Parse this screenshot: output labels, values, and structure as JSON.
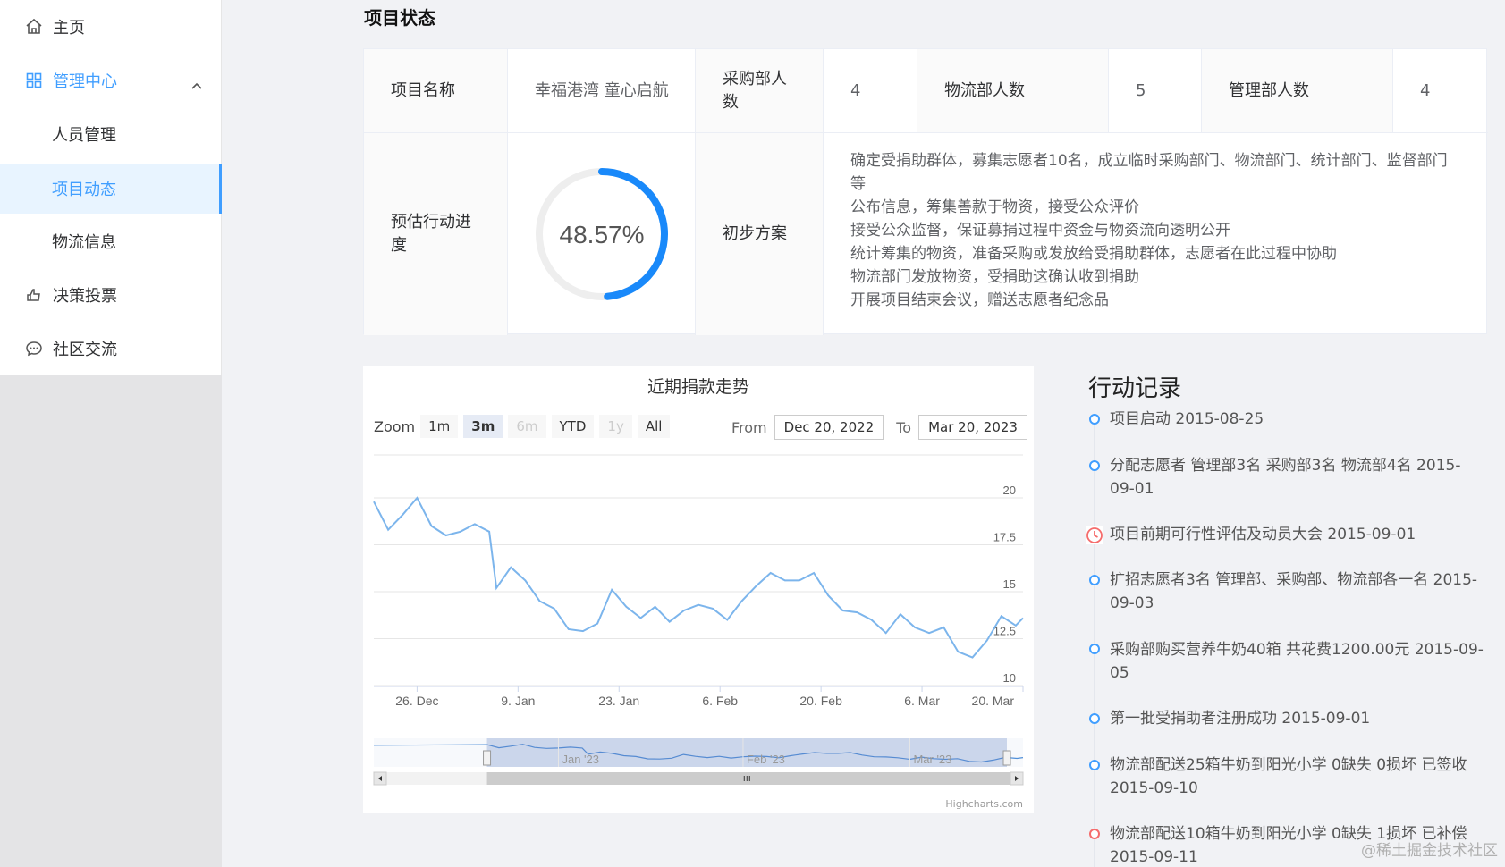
{
  "sidebar": {
    "items": [
      {
        "label": "主页",
        "icon": "home-icon"
      },
      {
        "label": "管理中心",
        "icon": "grid-icon"
      },
      {
        "label": "人员管理"
      },
      {
        "label": "项目动态"
      },
      {
        "label": "物流信息"
      },
      {
        "label": "决策投票",
        "icon": "vote-icon"
      },
      {
        "label": "社区交流",
        "icon": "chat-icon"
      }
    ],
    "accent": "#409eff"
  },
  "status": {
    "title": "项目状态",
    "project_name_label": "项目名称",
    "project_name": "幸福港湾 童心启航",
    "purchase_label": "采购部人数",
    "purchase_count": "4",
    "logistics_label": "物流部人数",
    "logistics_count": "5",
    "management_label": "管理部人数",
    "management_count": "4",
    "progress_label": "预估行动进度",
    "progress_text": "48.57%",
    "progress_value": 48.57,
    "plan_label": "初步方案",
    "plan_lines": [
      "确定受捐助群体，募集志愿者10名，成立临时采购部门、物流部门、统计部门、监督部门等",
      "公布信息，筹集善款于物资，接受公众评价",
      "接受公众监督，保证募捐过程中资金与物资流向透明公开",
      "统计筹集的物资，准备采购或发放给受捐助群体，志愿者在此过程中协助",
      "物流部门发放物资，受捐助这确认收到捐助",
      "开展项目结束会议，赠送志愿者纪念品"
    ]
  },
  "chart": {
    "zoom_label": "Zoom",
    "zoom_buttons": [
      "1m",
      "3m",
      "6m",
      "YTD",
      "1y",
      "All"
    ],
    "from_label": "From",
    "from_value": "Dec 20, 2022",
    "to_label": "To",
    "to_value": "Mar 20, 2023",
    "navigator_labels": [
      "Jan '23",
      "Feb '23",
      "Mar '23"
    ],
    "credits": "Highcharts.com",
    "line_color": "#7cb5ec"
  },
  "chart_data": {
    "type": "line",
    "title": "近期捐款走势",
    "x_tick_labels": [
      "26. Dec",
      "9. Jan",
      "23. Jan",
      "6. Feb",
      "20. Feb",
      "6. Mar",
      "20. Mar"
    ],
    "y_tick_labels": [
      "10",
      "12.5",
      "15",
      "17.5",
      "20"
    ],
    "ylim": [
      10,
      20
    ],
    "xlim": [
      "2022-12-20",
      "2023-03-20"
    ],
    "grid": true,
    "series": [
      {
        "x": [
          "2022-12-20",
          "2022-12-22",
          "2022-12-24",
          "2022-12-26",
          "2022-12-28",
          "2022-12-30",
          "2023-01-01",
          "2023-01-03",
          "2023-01-05",
          "2023-01-06",
          "2023-01-08",
          "2023-01-10",
          "2023-01-12",
          "2023-01-14",
          "2023-01-16",
          "2023-01-18",
          "2023-01-20",
          "2023-01-22",
          "2023-01-24",
          "2023-01-26",
          "2023-01-28",
          "2023-01-30",
          "2023-02-01",
          "2023-02-03",
          "2023-02-05",
          "2023-02-07",
          "2023-02-09",
          "2023-02-11",
          "2023-02-13",
          "2023-02-15",
          "2023-02-17",
          "2023-02-19",
          "2023-02-21",
          "2023-02-23",
          "2023-02-25",
          "2023-02-27",
          "2023-03-01",
          "2023-03-03",
          "2023-03-05",
          "2023-03-07",
          "2023-03-09",
          "2023-03-11",
          "2023-03-13",
          "2023-03-15",
          "2023-03-17",
          "2023-03-19",
          "2023-03-20"
        ],
        "values": [
          19.8,
          18.3,
          19.1,
          20.0,
          18.5,
          18.0,
          18.2,
          18.6,
          18.2,
          15.2,
          16.3,
          15.6,
          14.5,
          14.1,
          13.0,
          12.9,
          13.3,
          15.1,
          14.2,
          13.6,
          14.2,
          13.4,
          14.0,
          14.3,
          14.1,
          13.5,
          14.5,
          15.3,
          16.0,
          15.6,
          15.6,
          16.0,
          14.8,
          14.0,
          13.9,
          13.5,
          12.8,
          13.8,
          13.1,
          12.8,
          13.1,
          11.8,
          11.5,
          12.4,
          13.7,
          13.2,
          13.6
        ]
      }
    ]
  },
  "timeline": {
    "title": "行动记录",
    "items": [
      {
        "text": "项目启动 2015-08-25",
        "type": "blue"
      },
      {
        "text": "分配志愿者 管理部3名 采购部3名 物流部4名 2015-09-01",
        "type": "blue"
      },
      {
        "text": "项目前期可行性评估及动员大会 2015-09-01",
        "type": "clock"
      },
      {
        "text": "扩招志愿者3名 管理部、采购部、物流部各一名 2015-09-03",
        "type": "blue"
      },
      {
        "text": "采购部购买营养牛奶40箱 共花费1200.00元 2015-09-05",
        "type": "blue"
      },
      {
        "text": "第一批受捐助者注册成功 2015-09-01",
        "type": "blue"
      },
      {
        "text": "物流部配送25箱牛奶到阳光小学 0缺失 0损坏 已签收 2015-09-10",
        "type": "blue"
      },
      {
        "text": "物流部配送10箱牛奶到阳光小学 0缺失 1损坏 已补偿 2015-09-11",
        "type": "red"
      }
    ]
  },
  "watermark": "@稀土掘金技术社区"
}
